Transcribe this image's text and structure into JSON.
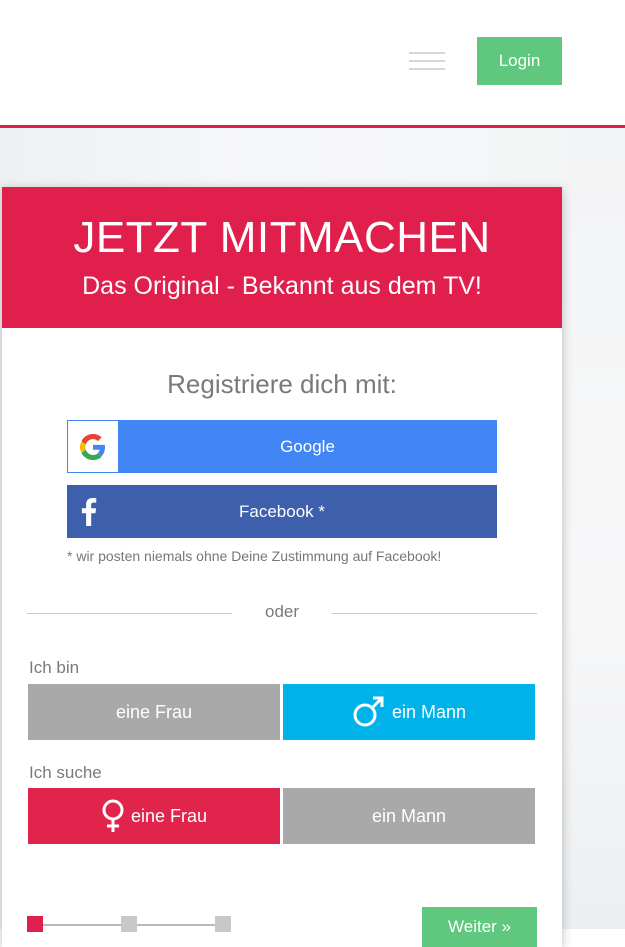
{
  "header": {
    "login_label": "Login"
  },
  "hero": {
    "title": "JETZT MITMACHEN",
    "subtitle": "Das Original - Bekannt aus dem TV!"
  },
  "register": {
    "label": "Registriere dich mit:",
    "google_label": "Google",
    "facebook_label": "Facebook *",
    "facebook_note": "* wir posten niemals ohne Deine Zustimmung auf Facebook!"
  },
  "divider": {
    "text": "oder"
  },
  "gender": {
    "label": "Ich bin",
    "options": [
      "eine Frau",
      "ein Mann"
    ],
    "selected": "ein Mann"
  },
  "seeking": {
    "label": "Ich suche",
    "options": [
      "eine Frau",
      "ein Mann"
    ],
    "selected": "eine Frau"
  },
  "progress": {
    "current_step": 1,
    "total_steps": 3
  },
  "colors": {
    "accent_red": "#e01f4d",
    "login_green": "#5fc87e",
    "google_blue": "#4285f4",
    "facebook_blue": "#3d5fac",
    "male_blue": "#00b2ea",
    "unselected_grey": "#a9a9a9"
  },
  "next_label": "Weiter »"
}
